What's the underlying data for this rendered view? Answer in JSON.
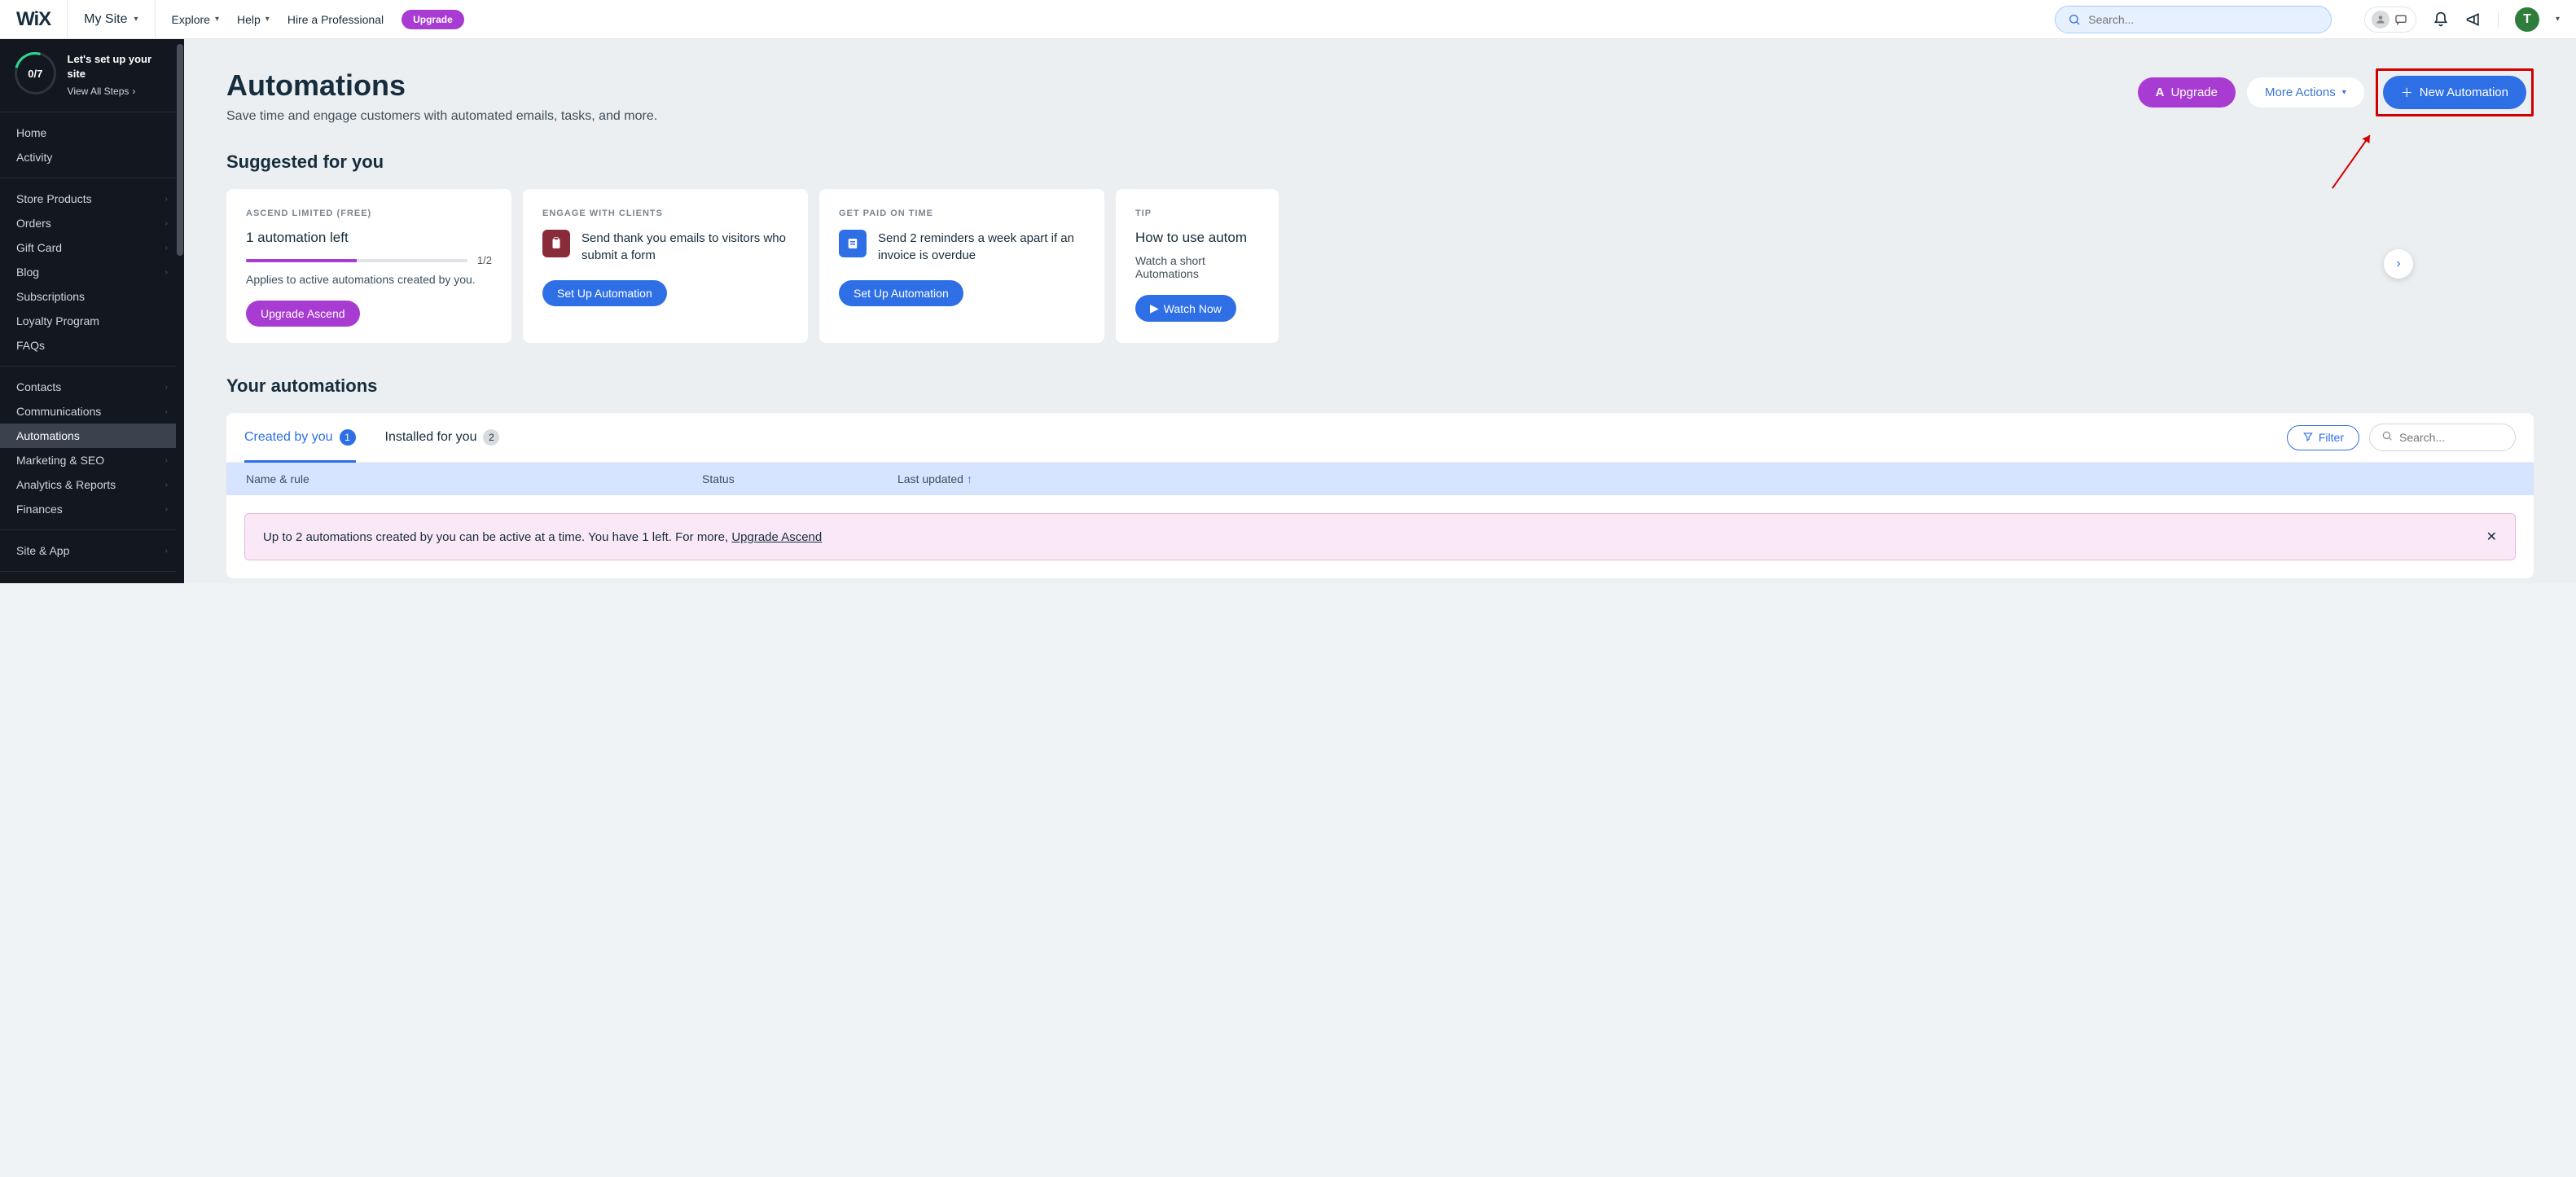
{
  "top": {
    "logo": "WiX",
    "site": "My Site",
    "nav": [
      "Explore",
      "Help",
      "Hire a Professional"
    ],
    "upgrade": "Upgrade",
    "search_placeholder": "Search...",
    "avatar_letter": "T"
  },
  "setup": {
    "progress": "0/7",
    "title": "Let's set up your site",
    "link": "View All Steps"
  },
  "sidebar": {
    "section1": [
      "Home",
      "Activity"
    ],
    "section2": [
      {
        "label": "Store Products",
        "chev": true
      },
      {
        "label": "Orders",
        "chev": true
      },
      {
        "label": "Gift Card",
        "chev": true
      },
      {
        "label": "Blog",
        "chev": true
      },
      {
        "label": "Subscriptions",
        "chev": false
      },
      {
        "label": "Loyalty Program",
        "chev": false
      },
      {
        "label": "FAQs",
        "chev": false
      }
    ],
    "section3": [
      {
        "label": "Contacts",
        "chev": true
      },
      {
        "label": "Communications",
        "chev": true
      },
      {
        "label": "Automations",
        "chev": false,
        "active": true
      },
      {
        "label": "Marketing & SEO",
        "chev": true
      },
      {
        "label": "Analytics & Reports",
        "chev": true
      },
      {
        "label": "Finances",
        "chev": true
      }
    ],
    "section4": [
      {
        "label": "Site & App",
        "chev": true
      }
    ]
  },
  "page": {
    "title": "Automations",
    "subtitle": "Save time and engage customers with automated emails, tasks, and more.",
    "upgrade_btn": "Upgrade",
    "more_actions": "More Actions",
    "new_automation": "New Automation"
  },
  "suggested": {
    "title": "Suggested for you",
    "cards": [
      {
        "eyebrow": "ASCEND LIMITED (FREE)",
        "headline": "1 automation left",
        "progress_label": "1/2",
        "note": "Applies to active automations created by you.",
        "cta": "Upgrade Ascend"
      },
      {
        "eyebrow": "ENGAGE WITH CLIENTS",
        "text": "Send thank you emails to visitors who submit a form",
        "cta": "Set Up Automation"
      },
      {
        "eyebrow": "GET PAID ON TIME",
        "text": "Send 2 reminders a week apart if an invoice is overdue",
        "cta": "Set Up Automation"
      },
      {
        "eyebrow": "TIP",
        "headline": "How to use autom",
        "note": "Watch a short Automations",
        "cta": "Watch Now"
      }
    ]
  },
  "your_automations": {
    "title": "Your automations",
    "tabs": [
      {
        "label": "Created by you",
        "count": "1",
        "active": true
      },
      {
        "label": "Installed for you",
        "count": "2",
        "active": false
      }
    ],
    "filter": "Filter",
    "search_placeholder": "Search...",
    "columns": [
      "Name & rule",
      "Status",
      "Last updated"
    ],
    "notice_text": "Up to 2 automations created by you can be active at a time. You have 1 left. For more, ",
    "notice_link": "Upgrade Ascend"
  }
}
